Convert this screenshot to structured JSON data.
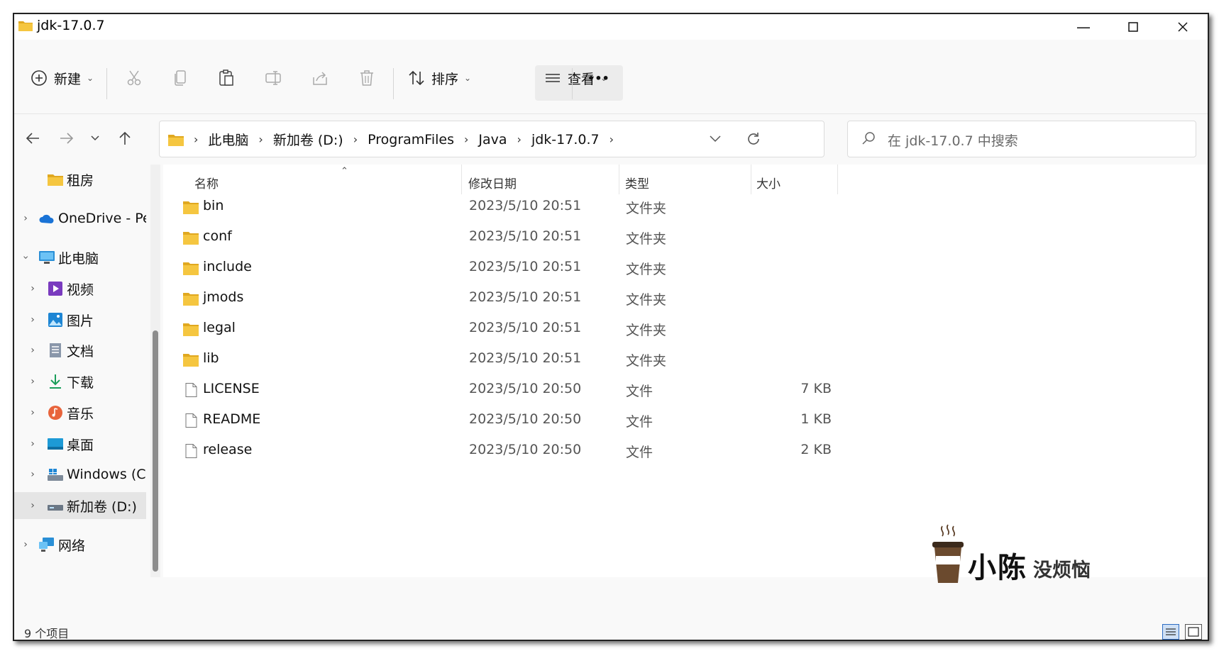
{
  "window": {
    "title": "jdk-17.0.7"
  },
  "toolbar": {
    "new_label": "新建",
    "sort_label": "排序",
    "view_label": "查看",
    "more_label": "•••"
  },
  "address": {
    "crumbs": [
      "此电脑",
      "新加卷 (D:)",
      "ProgramFiles",
      "Java",
      "jdk-17.0.7"
    ]
  },
  "search": {
    "placeholder": "在 jdk-17.0.7 中搜索"
  },
  "sidebar": {
    "items": [
      {
        "label": "租房",
        "icon": "folder-icon"
      },
      {
        "label": "OneDrive - Pers",
        "icon": "onedrive-icon"
      },
      {
        "label": "此电脑",
        "icon": "computer-icon"
      },
      {
        "label": "视频",
        "icon": "video-icon"
      },
      {
        "label": "图片",
        "icon": "pictures-icon"
      },
      {
        "label": "文档",
        "icon": "documents-icon"
      },
      {
        "label": "下载",
        "icon": "download-icon"
      },
      {
        "label": "音乐",
        "icon": "music-icon"
      },
      {
        "label": "桌面",
        "icon": "desktop-icon"
      },
      {
        "label": "Windows (C:)",
        "icon": "drive-c-icon"
      },
      {
        "label": "新加卷 (D:)",
        "icon": "drive-d-icon"
      },
      {
        "label": "网络",
        "icon": "network-icon"
      }
    ]
  },
  "columns": {
    "name": "名称",
    "date": "修改日期",
    "type": "类型",
    "size": "大小"
  },
  "files": [
    {
      "name": "bin",
      "date": "2023/5/10 20:51",
      "type": "文件夹",
      "size": "",
      "kind": "folder"
    },
    {
      "name": "conf",
      "date": "2023/5/10 20:51",
      "type": "文件夹",
      "size": "",
      "kind": "folder"
    },
    {
      "name": "include",
      "date": "2023/5/10 20:51",
      "type": "文件夹",
      "size": "",
      "kind": "folder"
    },
    {
      "name": "jmods",
      "date": "2023/5/10 20:51",
      "type": "文件夹",
      "size": "",
      "kind": "folder"
    },
    {
      "name": "legal",
      "date": "2023/5/10 20:51",
      "type": "文件夹",
      "size": "",
      "kind": "folder"
    },
    {
      "name": "lib",
      "date": "2023/5/10 20:51",
      "type": "文件夹",
      "size": "",
      "kind": "folder"
    },
    {
      "name": "LICENSE",
      "date": "2023/5/10 20:50",
      "type": "文件",
      "size": "7 KB",
      "kind": "file"
    },
    {
      "name": "README",
      "date": "2023/5/10 20:50",
      "type": "文件",
      "size": "1 KB",
      "kind": "file"
    },
    {
      "name": "release",
      "date": "2023/5/10 20:50",
      "type": "文件",
      "size": "2 KB",
      "kind": "file"
    }
  ],
  "status": {
    "item_count": "9 个项目"
  },
  "watermark": {
    "name": "小陈",
    "sub": "没烦恼"
  },
  "colors": {
    "folder": "#f5c640",
    "folder_dark": "#e0a820",
    "accent": "#2d6dc4"
  }
}
